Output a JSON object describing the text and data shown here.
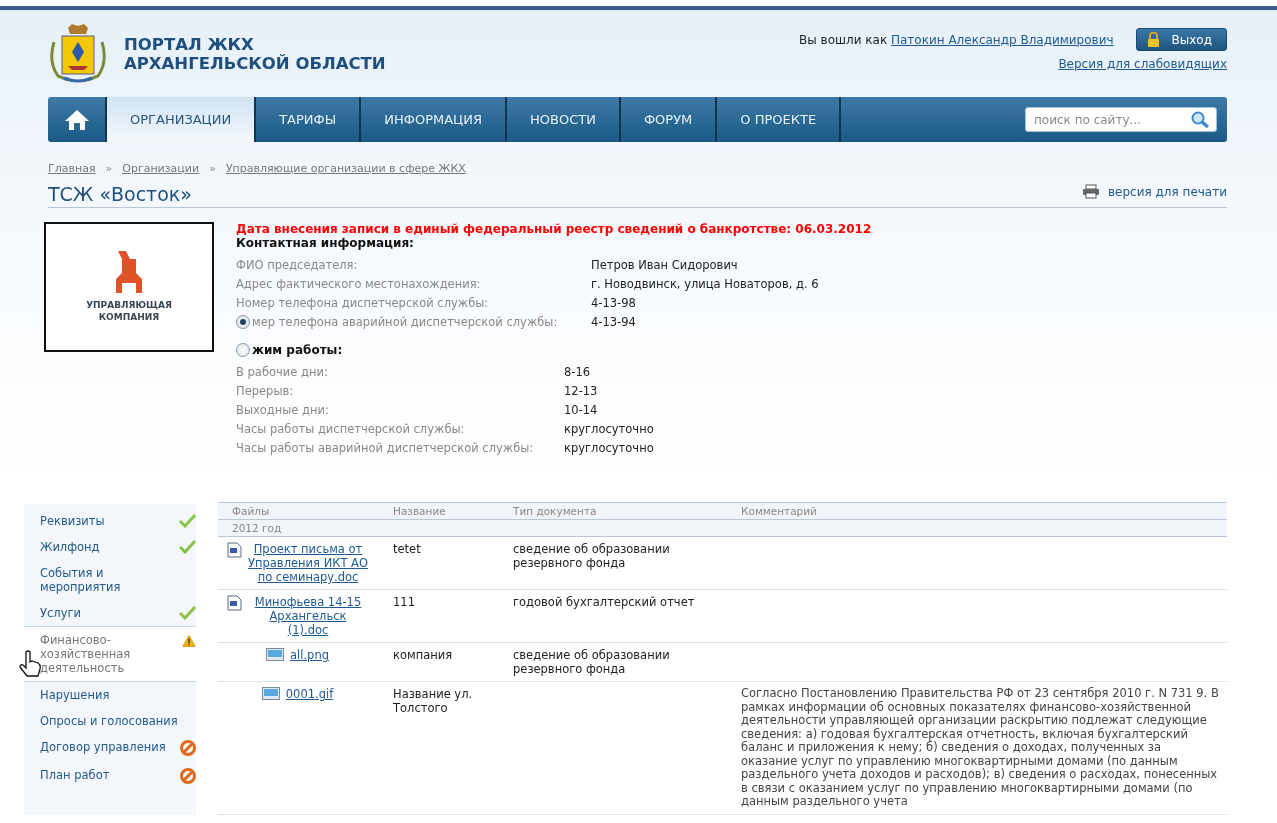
{
  "header": {
    "title_lines": [
      "ПОРТАЛ ЖКХ",
      "АРХАНГЕЛЬСКОЙ ОБЛАСТИ"
    ],
    "logged_in_text": "Вы вошли как",
    "user_name": "Патокин Александр Владимирович",
    "logout_button": "Выход",
    "accessibility_link": "Версия для слабовидящих"
  },
  "nav": {
    "tabs": [
      {
        "label": "ОРГАНИЗАЦИИ",
        "selected": true
      },
      {
        "label": "ТАРИФЫ",
        "selected": false
      },
      {
        "label": "ИНФОРМАЦИЯ",
        "selected": false
      },
      {
        "label": "НОВОСТИ",
        "selected": false
      },
      {
        "label": "ФОРУМ",
        "selected": false
      },
      {
        "label": "О ПРОЕКТЕ",
        "selected": false
      }
    ],
    "search": {
      "placeholder": "поиск по сайту..."
    }
  },
  "breadcrumbs": [
    "Главная",
    "Организации",
    "Управляющие организации в сфере ЖКХ"
  ],
  "breadcrumb_separator": "»",
  "page_title": "ТСЖ «Восток»",
  "print_link": "версия для печати",
  "logo_card": {
    "lines": [
      "УПРАВЛЯЮЩАЯ",
      "КОМПАНИЯ"
    ]
  },
  "bankruptcy_notice": "Дата внесения записи в единый федеральный реестр сведений о банкротстве: 06.03.2012",
  "contact": {
    "heading": "Контактная информация:",
    "rows": [
      {
        "label": "ФИО председателя:",
        "value": "Петров Иван Сидорович"
      },
      {
        "label": "Адрес фактического местонахождения:",
        "value": "г. Новодвинск, улица Новаторов, д. 6"
      },
      {
        "label": "Номер телефона диспетчерской службы:",
        "value": "4-13-98"
      },
      {
        "label": "мер телефона аварийной диспетчерской службы:",
        "value": "4-13-94",
        "radio": {
          "selected": true
        }
      }
    ]
  },
  "schedule": {
    "heading": "жим работы:",
    "radio": {
      "selected": false
    },
    "rows": [
      {
        "label": "В рабочие дни:",
        "value": "8-16"
      },
      {
        "label": "Перерыв:",
        "value": "12-13"
      },
      {
        "label": "Выходные дни:",
        "value": "10-14"
      },
      {
        "label": "Часы работы диспетчерской службы:",
        "value": "круглосуточно"
      },
      {
        "label": "Часы работы аварийной диспетчерской службы:",
        "value": "круглосуточно"
      }
    ]
  },
  "sidebar": {
    "items": [
      {
        "label": "Реквизиты",
        "kind": "ok",
        "selected": false
      },
      {
        "label": "Жилфонд",
        "kind": "ok",
        "selected": false
      },
      {
        "label": "События и мероприятия",
        "kind": "plain",
        "selected": false
      },
      {
        "label": "Услуги",
        "kind": "ok",
        "selected": false
      },
      {
        "label": "Финансово-хозяйственная деятельность",
        "kind": "warning",
        "selected": true
      },
      {
        "label": "Нарушения",
        "kind": "plain",
        "selected": false
      },
      {
        "label": "Опросы и голосования",
        "kind": "plain",
        "selected": false
      },
      {
        "label": "Договор управления",
        "kind": "blocked",
        "selected": false
      },
      {
        "label": "План работ",
        "kind": "blocked",
        "selected": false
      }
    ]
  },
  "files_table": {
    "columns": [
      "Файлы",
      "Название",
      "Тип документа",
      "Комментарий"
    ],
    "group": "2012 год",
    "rows": [
      {
        "file": "Проект письма от Управления ИКТ АО по семинару.doc",
        "kind": "doc",
        "name": "tetet",
        "doc_type": "сведение об образовании резервного фонда",
        "comment": ""
      },
      {
        "file": "Минофьева 14-15 Архангельск (1).doc",
        "kind": "doc",
        "name": "111",
        "doc_type": "годовой бухгалтерский отчет",
        "comment": ""
      },
      {
        "file": "all.png",
        "kind": "image",
        "name": "компания",
        "doc_type": "сведение об образовании резервного фонда",
        "comment": ""
      },
      {
        "file": "0001.gif",
        "kind": "image",
        "name": "Название ул. Толстого",
        "doc_type": "",
        "comment": "Согласно Постановлению Правительства РФ от 23 сентября 2010 г. N 731 9. В рамках информации об основных показателях финансово-хозяйственной деятельности управляющей организации раскрытию подлежат следующие сведения: а) годовая бухгалтерская отчетность, включая бухгалтерский баланс и приложения к нему; б) сведения о доходах, полученных за оказание услуг по управлению многоквартирными домами (по данным раздельного учета доходов и расходов); в) сведения о расходах, понесенных в связи с оказанием услуг по управлению многоквартирными домами (по данным раздельного учета"
      }
    ]
  }
}
